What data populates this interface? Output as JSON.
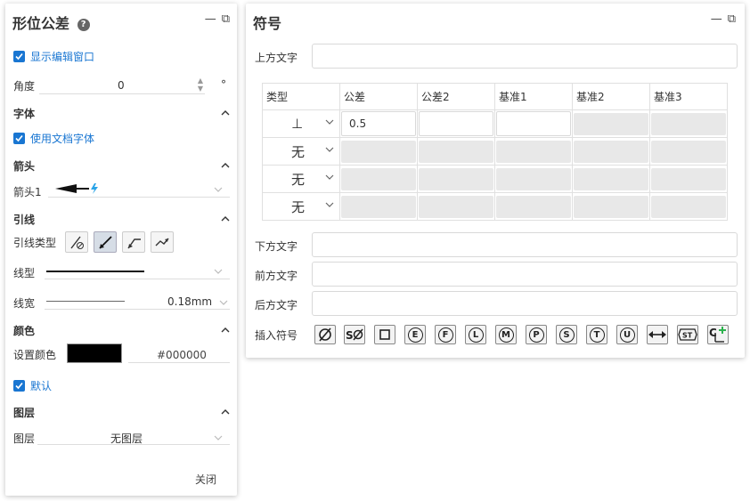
{
  "left_panel": {
    "title": "形位公差",
    "show_edit_window": "显示编辑窗口",
    "angle_label": "角度",
    "angle_value": "0",
    "angle_unit": "°",
    "font_section": "字体",
    "use_doc_font": "使用文档字体",
    "arrow_section": "箭头",
    "arrow_label": "箭头1",
    "leader_section": "引线",
    "leader_type_label": "引线类型",
    "line_type_label": "线型",
    "line_width_label": "线宽",
    "line_width_value": "0.18mm",
    "color_section": "颜色",
    "set_color_label": "设置颜色",
    "color_hex": "#000000",
    "default_label": "默认",
    "layer_section": "图层",
    "layer_label": "图层",
    "layer_value": "无图层",
    "close_label": "关闭"
  },
  "right_panel": {
    "title": "符号",
    "top_text_label": "上方文字",
    "bottom_text_label": "下方文字",
    "front_text_label": "前方文字",
    "back_text_label": "后方文字",
    "insert_symbol_label": "插入符号",
    "table_headers": [
      "类型",
      "公差",
      "公差2",
      "基准1",
      "基准2",
      "基准3"
    ],
    "rows": [
      {
        "type": "⊥",
        "tolerance": "0.5"
      },
      {
        "type": "无",
        "tolerance": ""
      },
      {
        "type": "无",
        "tolerance": ""
      },
      {
        "type": "无",
        "tolerance": ""
      }
    ],
    "symbol_letters": [
      "E",
      "F",
      "L",
      "M",
      "P",
      "S",
      "T",
      "U"
    ]
  },
  "colors": {
    "accent": "#1976d2",
    "swatch": "#000000"
  }
}
